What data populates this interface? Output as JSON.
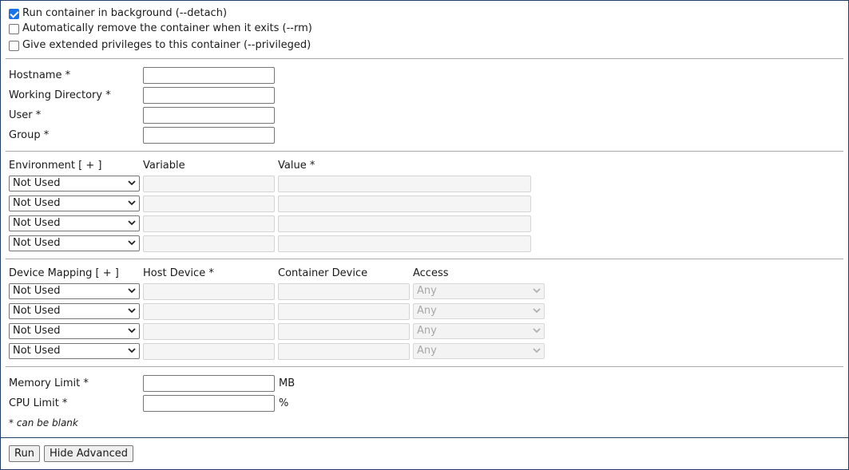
{
  "options": {
    "detach_label": "Run container in background (--detach)",
    "detach_checked": true,
    "rm_label": "Automatically remove the container when it exits (--rm)",
    "rm_checked": false,
    "privileged_label": "Give extended privileges to this container (--privileged)",
    "privileged_checked": false
  },
  "basic": {
    "hostname_label": "Hostname *",
    "hostname_value": "",
    "workdir_label": "Working Directory *",
    "workdir_value": "",
    "user_label": "User *",
    "user_value": "",
    "group_label": "Group *",
    "group_value": ""
  },
  "environment": {
    "header_label": "Environment [ + ]",
    "variable_header": "Variable",
    "value_header": "Value *",
    "rows": [
      {
        "mode": "Not Used",
        "variable": "",
        "value": ""
      },
      {
        "mode": "Not Used",
        "variable": "",
        "value": ""
      },
      {
        "mode": "Not Used",
        "variable": "",
        "value": ""
      },
      {
        "mode": "Not Used",
        "variable": "",
        "value": ""
      }
    ]
  },
  "devices": {
    "header_label": "Device Mapping [ + ]",
    "host_header": "Host Device *",
    "container_header": "Container Device",
    "access_header": "Access",
    "rows": [
      {
        "mode": "Not Used",
        "host": "",
        "container": "",
        "access": "Any"
      },
      {
        "mode": "Not Used",
        "host": "",
        "container": "",
        "access": "Any"
      },
      {
        "mode": "Not Used",
        "host": "",
        "container": "",
        "access": "Any"
      },
      {
        "mode": "Not Used",
        "host": "",
        "container": "",
        "access": "Any"
      }
    ]
  },
  "limits": {
    "memory_label": "Memory Limit *",
    "memory_value": "",
    "memory_unit": "MB",
    "cpu_label": "CPU Limit *",
    "cpu_value": "",
    "cpu_unit": "%",
    "footnote": "* can be blank"
  },
  "actions": {
    "run_label": "Run",
    "hide_advanced_label": "Hide Advanced"
  },
  "colors": {
    "checkbox_accent": "#1a73e8",
    "frame_border": "#1f3f66"
  }
}
